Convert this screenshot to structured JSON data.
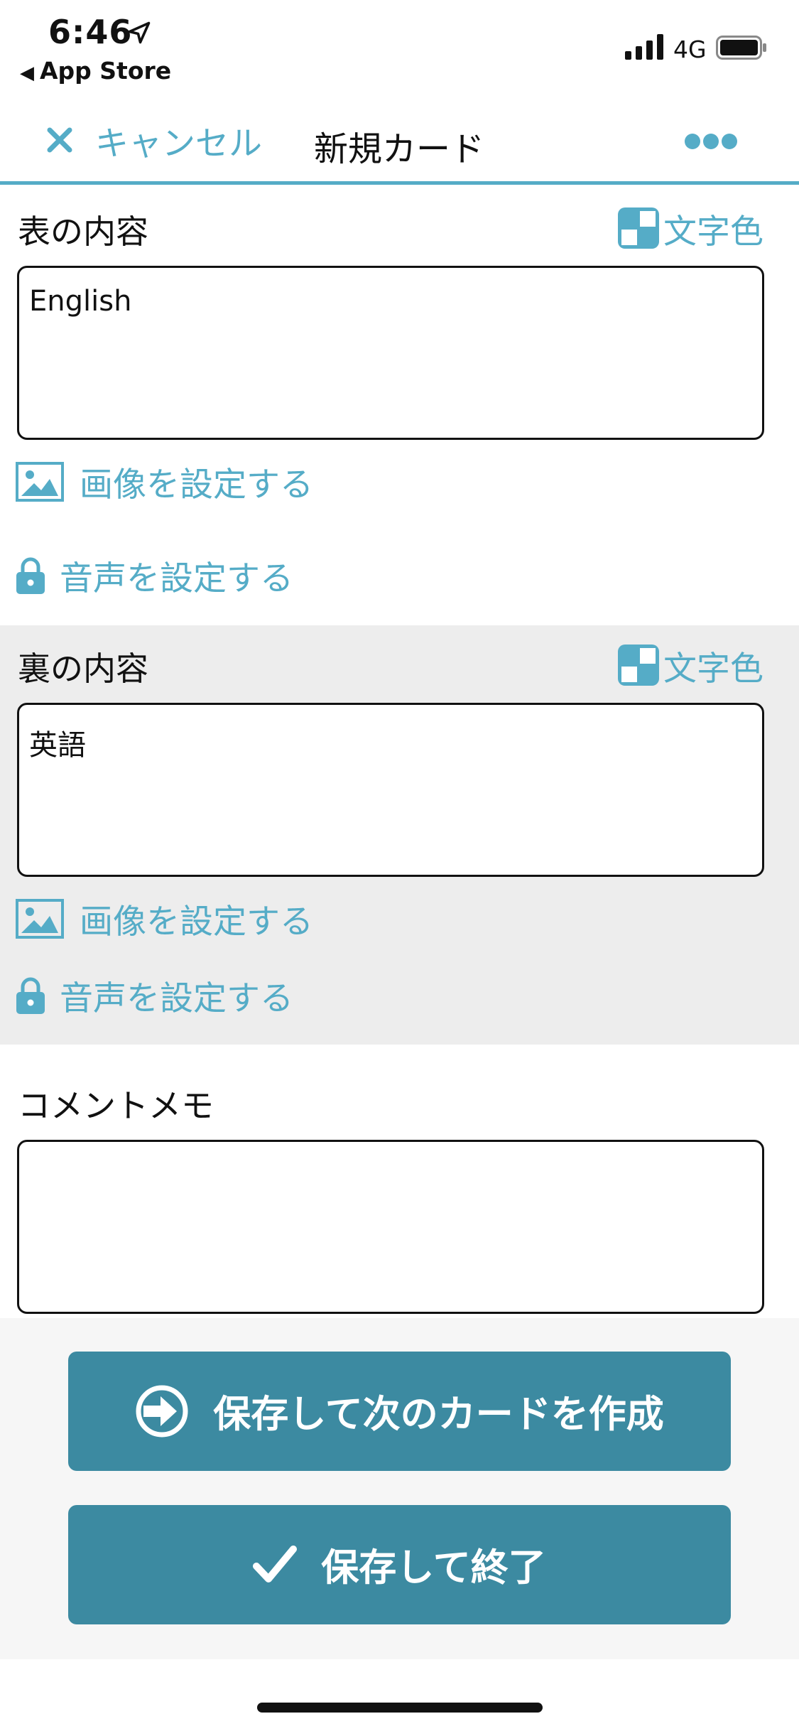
{
  "status_bar": {
    "time": "6:46",
    "back_app": "App Store",
    "network": "4G"
  },
  "nav": {
    "cancel_label": "キャンセル",
    "title": "新規カード"
  },
  "front": {
    "label": "表の内容",
    "color_label": "文字色",
    "text": "English",
    "image_link": "画像を設定する",
    "audio_link": "音声を設定する"
  },
  "back": {
    "label": "裏の内容",
    "color_label": "文字色",
    "text": "英語",
    "image_link": "画像を設定する",
    "audio_link": "音声を設定する"
  },
  "memo": {
    "label": "コメントメモ",
    "text": ""
  },
  "actions": {
    "save_next_label": "保存して次のカードを作成",
    "save_exit_label": "保存して終了"
  },
  "colors": {
    "accent": "#55acc7",
    "button": "#3c8aa1",
    "back_section_bg": "#ededed"
  }
}
